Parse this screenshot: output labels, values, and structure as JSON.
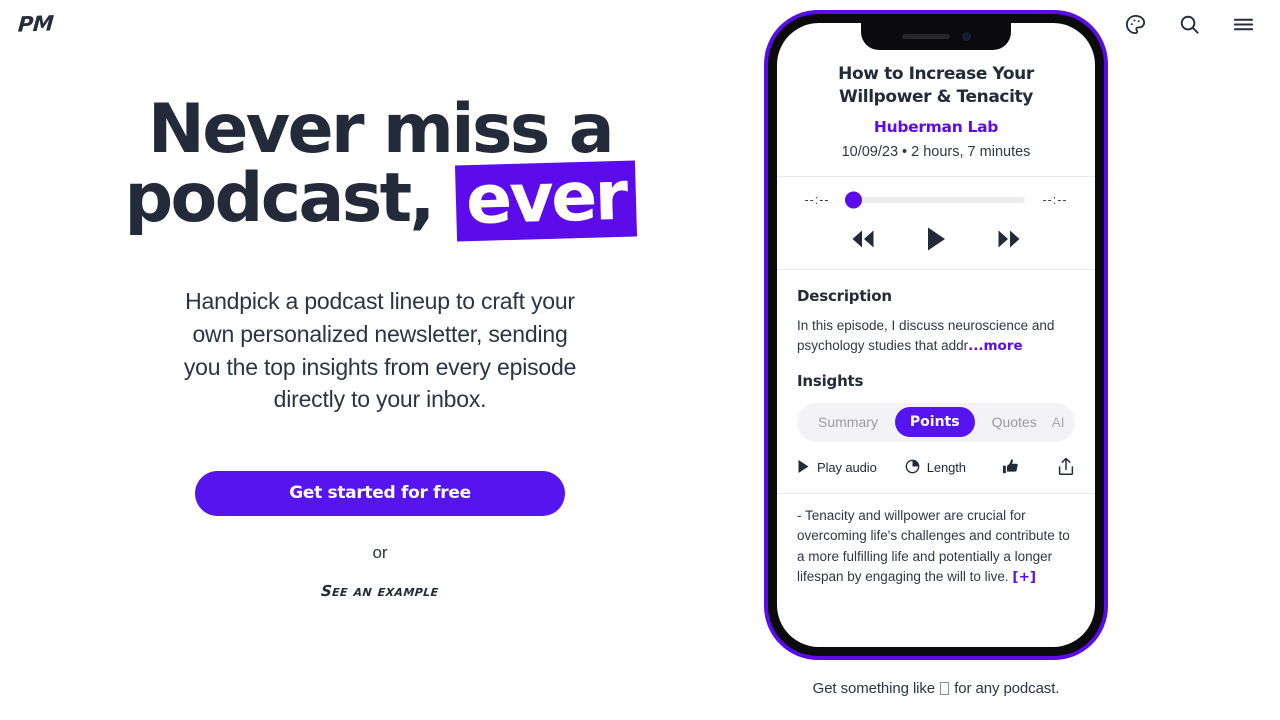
{
  "header": {
    "logo": "PM",
    "icons": [
      {
        "name": "palette-icon",
        "label": "Theme"
      },
      {
        "name": "search-icon",
        "label": "Search"
      },
      {
        "name": "hamburger-menu-icon",
        "label": "Menu"
      }
    ]
  },
  "hero": {
    "title_part1": "Never miss a podcast,",
    "title_highlight": "ever",
    "subtitle": "Handpick a podcast lineup to craft your own personalized newsletter, sending you the top insights from every episode directly to your inbox.",
    "cta_label": "Get started for free",
    "or_label": "or",
    "example_link": "See an example"
  },
  "phone": {
    "episode": {
      "title": "How to Increase Your Willpower & Tenacity",
      "show": "Huberman Lab",
      "meta": "10/09/23 • 2 hours, 7 minutes"
    },
    "player": {
      "elapsed": "--:--",
      "remaining": "--:--",
      "progress_percent": 0,
      "rewind_label": "Rewind",
      "play_label": "Play",
      "forward_label": "Fast forward"
    },
    "description": {
      "heading": "Description",
      "text": "In this episode, I discuss neuroscience and psychology studies that addr",
      "more_label": "...more"
    },
    "insights": {
      "heading": "Insights",
      "tabs": [
        {
          "label": "Summary",
          "active": false
        },
        {
          "label": "Points",
          "active": true
        },
        {
          "label": "Quotes",
          "active": false
        }
      ],
      "ai_label": "AI",
      "actions": [
        {
          "name": "play-audio",
          "label": "Play audio"
        },
        {
          "name": "length",
          "label": "Length"
        },
        {
          "name": "thumbs-up",
          "label": ""
        },
        {
          "name": "share",
          "label": ""
        }
      ],
      "body": "- Tenacity and willpower are crucial for overcoming life's challenges and contribute to a more fulfilling life and potentially a longer lifespan by engaging the will to live.",
      "expand_label": "[+]"
    }
  },
  "caption": {
    "before": "Get something like",
    "after": "for any podcast."
  },
  "colors": {
    "accent_purple": "#5c0ceb",
    "button_purple": "#5614ef",
    "text_dark": "#232b3b"
  }
}
